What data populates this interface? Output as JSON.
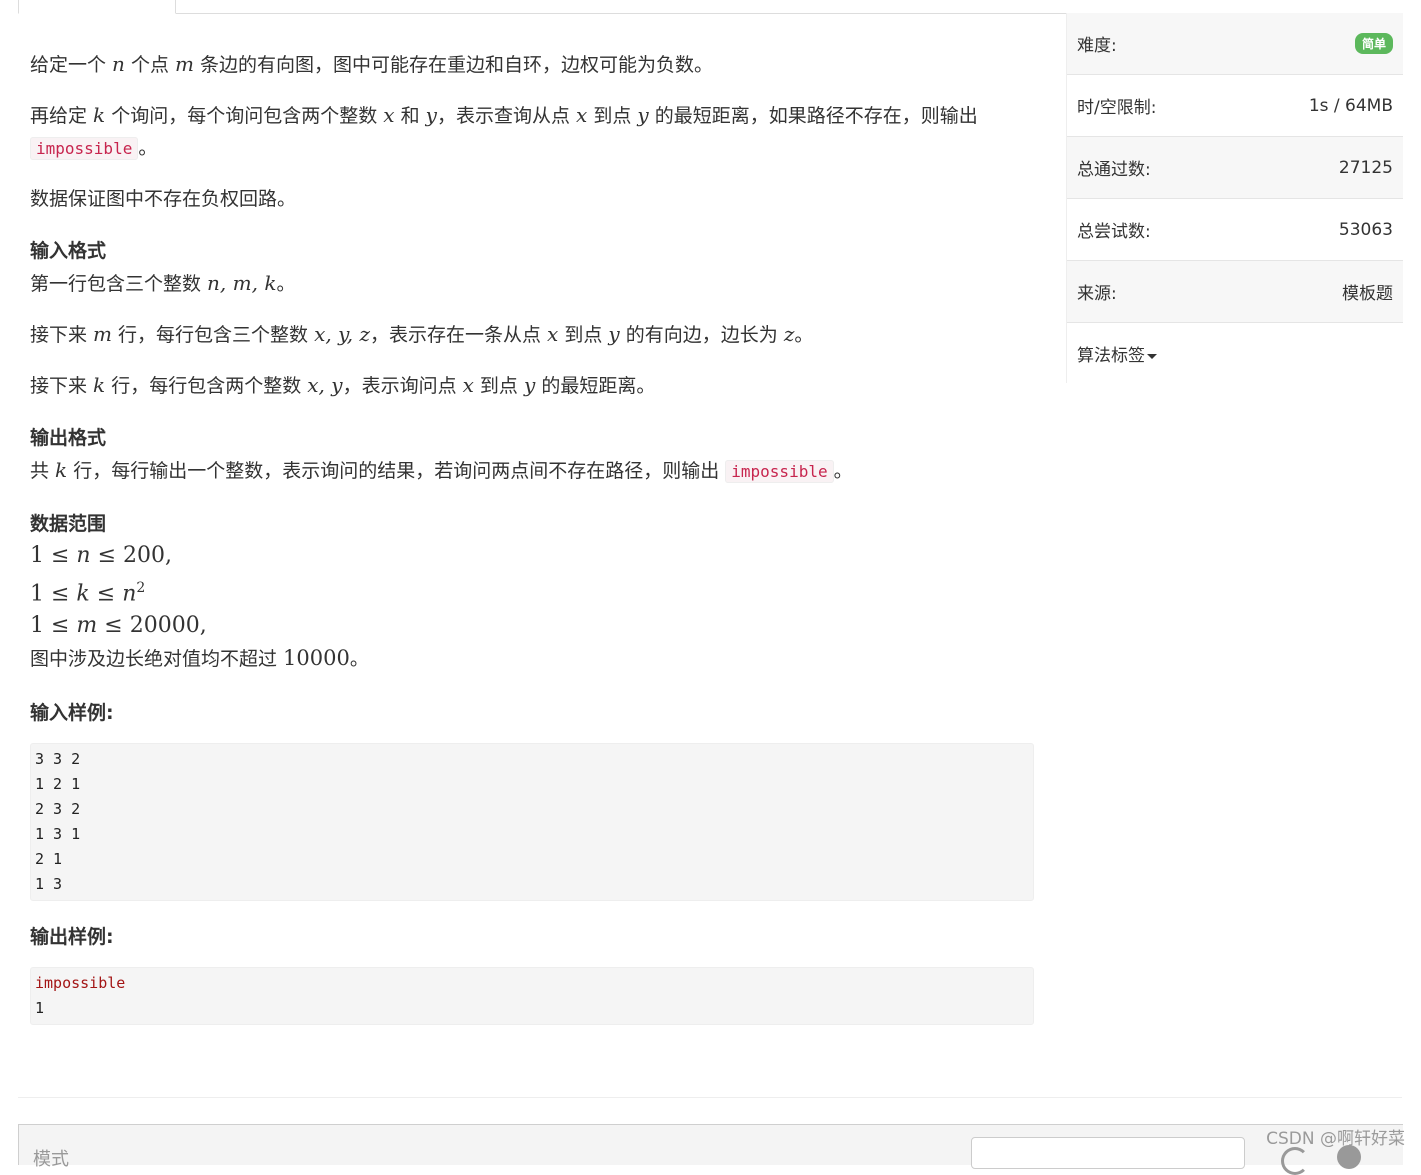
{
  "problem": {
    "p1": {
      "a": "给定一个 ",
      "n": "n",
      "b": " 个点 ",
      "m": "m",
      "c": " 条边的有向图，图中可能存在重边和自环，边权可能为负数。"
    },
    "p2": {
      "a": "再给定 ",
      "k": "k",
      "b": " 个询问，每个询问包含两个整数 ",
      "x": "x",
      "c": " 和 ",
      "y": "y",
      "d": "，表示查询从点 ",
      "x2": "x",
      "e": " 到点 ",
      "y2": "y",
      "f": " 的最短距离，如果路径不存在，则输出",
      "code": "impossible",
      "g": "。"
    },
    "p3": "数据保证图中不存在负权回路。",
    "input_title": "输入格式",
    "in1": {
      "a": "第一行包含三个整数 ",
      "vars": "n, m, k",
      "b": "。"
    },
    "in2": {
      "a": "接下来 ",
      "m": "m",
      "b": " 行，每行包含三个整数 ",
      "vars": "x, y, z",
      "c": "，表示存在一条从点 ",
      "x": "x",
      "d": " 到点 ",
      "y": "y",
      "e": " 的有向边，边长为 ",
      "z": "z",
      "f": "。"
    },
    "in3": {
      "a": "接下来 ",
      "k": "k",
      "b": " 行，每行包含两个整数 ",
      "vars": "x, y",
      "c": "，表示询问点 ",
      "x": "x",
      "d": " 到点 ",
      "y": "y",
      "e": " 的最短距离。"
    },
    "output_title": "输出格式",
    "out1": {
      "a": "共 ",
      "k": "k",
      "b": " 行，每行输出一个整数，表示询问的结果，若询问两点间不存在路径，则输出 ",
      "code": "impossible",
      "c": "。"
    },
    "range_title": "数据范围",
    "r1": {
      "a": "1 ≤ ",
      "v": "n",
      "b": " ≤ 200,"
    },
    "r2": {
      "a": "1 ≤ ",
      "v": "k",
      "b": " ≤ ",
      "v2": "n",
      "sup": "2"
    },
    "r3": {
      "a": "1 ≤ ",
      "v": "m",
      "b": " ≤ 20000,"
    },
    "r4": {
      "a": "图中涉及边长绝对值均不超过 ",
      "num": "10000",
      "b": "。"
    },
    "sample_in_title": "输入样例:",
    "sample_in": "3 3 2\n1 2 1\n2 3 2\n1 3 1\n2 1\n1 3",
    "sample_out_title": "输出样例:",
    "sample_out_first": "impossible",
    "sample_out_rest": "1"
  },
  "sidebar": {
    "difficulty_label": "难度:",
    "difficulty_value": "简单",
    "limit_label": "时/空限制:",
    "limit_value": "1s / 64MB",
    "passed_label": "总通过数:",
    "passed_value": "27125",
    "tried_label": "总尝试数:",
    "tried_value": "53063",
    "source_label": "来源:",
    "source_value": "模板题",
    "tags_label": "算法标签"
  },
  "editor": {
    "mode_label": "模式"
  },
  "watermark": "CSDN @啊轩好菜",
  "colors": {
    "badge": "#5cb85c",
    "code_text": "#c7254e"
  }
}
